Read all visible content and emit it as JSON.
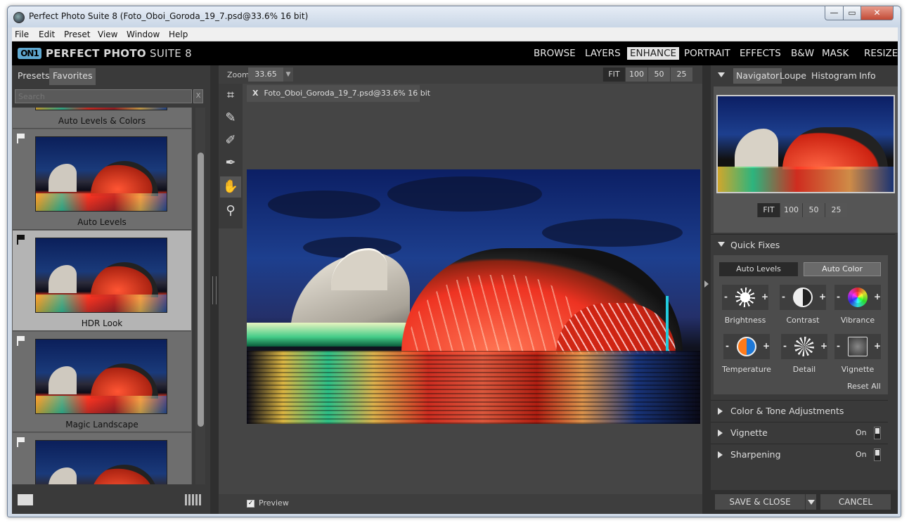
{
  "window": {
    "title": "Perfect Photo Suite 8 (Foto_Oboi_Goroda_19_7.psd@33.6% 16 bit)",
    "minimize": "—",
    "maximize": "▭",
    "close": "✕"
  },
  "menu": [
    "File",
    "Edit",
    "Preset",
    "View",
    "Window",
    "Help"
  ],
  "logo": {
    "mark": "ON1",
    "text_bold": "PERFECT PHOTO",
    "text_thin": " SUITE 8"
  },
  "modules": [
    {
      "label": "BROWSE",
      "active": false
    },
    {
      "label": "LAYERS",
      "active": false
    },
    {
      "label": "ENHANCE",
      "active": true
    },
    {
      "label": "PORTRAIT",
      "active": false
    },
    {
      "label": "EFFECTS",
      "active": false
    },
    {
      "label": "B&W",
      "active": false
    },
    {
      "label": "MASK",
      "active": false
    },
    {
      "label": "RESIZE",
      "active": false
    }
  ],
  "left_panel": {
    "tabs": [
      "Presets",
      "Favorites"
    ],
    "search_placeholder": "Search",
    "search_clear": "X",
    "presets": [
      {
        "label": "Auto Levels & Colors",
        "selected": false
      },
      {
        "label": "Auto Levels",
        "selected": false
      },
      {
        "label": "HDR Look",
        "selected": true
      },
      {
        "label": "Magic Landscape",
        "selected": false
      },
      {
        "label": "",
        "selected": false
      }
    ]
  },
  "zoom": {
    "label": "Zoom",
    "value": "33.65",
    "drop": "▼",
    "buttons": [
      "FIT",
      "100",
      "50",
      "25"
    ],
    "active": "FIT"
  },
  "tools": [
    "crop-icon",
    "retouch-brush-icon",
    "perfect-eraser-icon",
    "refine-brush-icon",
    "hand-icon",
    "zoom-icon"
  ],
  "document": {
    "close": "X",
    "name": "Foto_Oboi_Goroda_19_7.psd@33.6% 16 bit"
  },
  "preview": {
    "label": "Preview",
    "checked": "✓"
  },
  "right_panel": {
    "tabs": [
      "Navigator",
      "Loupe",
      "Histogram",
      "Info"
    ],
    "nav_buttons": [
      "FIT",
      "100",
      "50",
      "25"
    ],
    "quick_fixes": {
      "title": "Quick Fixes",
      "auto_levels": "Auto Levels",
      "auto_color": "Auto Color",
      "items": [
        "Brightness",
        "Contrast",
        "Vibrance",
        "Temperature",
        "Detail",
        "Vignette"
      ],
      "minus": "-",
      "plus": "+",
      "reset": "Reset All"
    },
    "sections": [
      {
        "title": "Color & Tone Adjustments",
        "state": ""
      },
      {
        "title": "Vignette",
        "state": "On"
      },
      {
        "title": "Sharpening",
        "state": "On"
      }
    ],
    "save_close": "SAVE & CLOSE",
    "cancel": "CANCEL"
  }
}
